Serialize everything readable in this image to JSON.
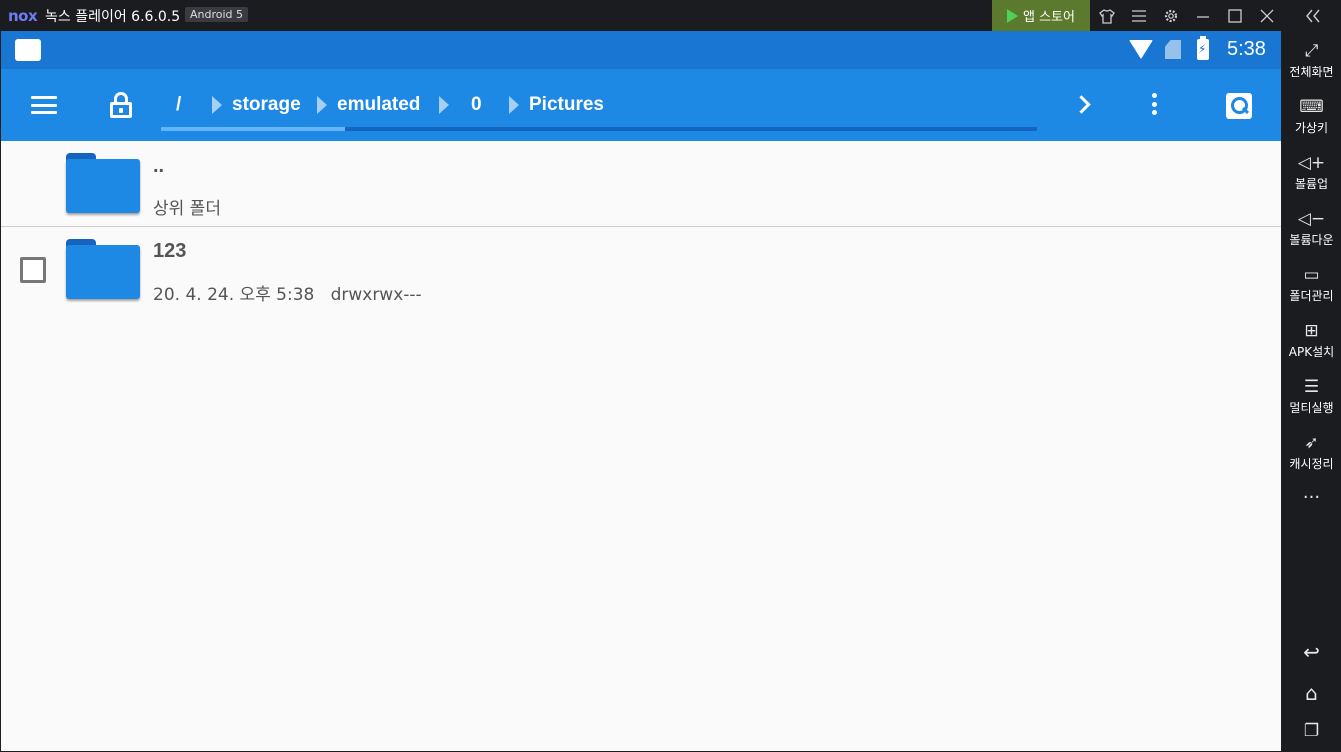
{
  "emulator": {
    "logo": "nox",
    "title": "녹스 플레이어 6.6.0.5",
    "android_badge": "Android 5",
    "store_label": "앱 스토어",
    "icons": [
      "shirt-icon",
      "menu-icon",
      "gear-icon",
      "minimize-icon",
      "maximize-icon",
      "close-icon",
      "collapse-icon"
    ]
  },
  "statusbar": {
    "time": "5:38",
    "battery_glyph": "⚡"
  },
  "toolbar": {
    "breadcrumbs": [
      "/",
      "storage",
      "emulated",
      "0",
      "Pictures"
    ]
  },
  "list": {
    "items": [
      {
        "name": "..",
        "subtitle": "상위 폴더"
      },
      {
        "name": "123",
        "subtitle": "20. 4. 24. 오후 5:38   drwxrwx---"
      }
    ]
  },
  "sidebar": {
    "items": [
      {
        "label": "전체화면",
        "icon": "fullscreen-icon",
        "glyph": "⤢"
      },
      {
        "label": "가상키",
        "icon": "keyboard-icon",
        "glyph": "⌨"
      },
      {
        "label": "볼륨업",
        "icon": "volume-up-icon",
        "glyph": "◁+"
      },
      {
        "label": "볼륨다운",
        "icon": "volume-down-icon",
        "glyph": "◁−"
      },
      {
        "label": "폴더관리",
        "icon": "folder-manage-icon",
        "glyph": "▭"
      },
      {
        "label": "APK설치",
        "icon": "apk-install-icon",
        "glyph": "⊞"
      },
      {
        "label": "멀티실행",
        "icon": "multi-instance-icon",
        "glyph": "☰"
      },
      {
        "label": "캐시정리",
        "icon": "rocket-icon",
        "glyph": "➶"
      }
    ],
    "more_glyph": "···",
    "nav": [
      {
        "icon": "back-icon",
        "glyph": "↩"
      },
      {
        "icon": "home-icon",
        "glyph": "⌂"
      },
      {
        "icon": "recents-icon",
        "glyph": "❐"
      }
    ]
  }
}
